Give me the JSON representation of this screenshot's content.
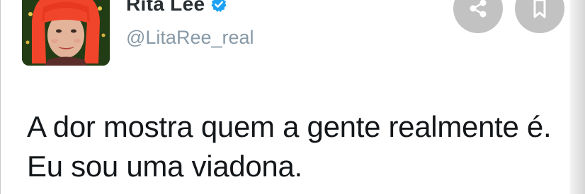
{
  "tweet": {
    "author": {
      "name": "Rita Lee",
      "handle": "@LitaRee_real",
      "verified": true
    },
    "text": "A dor mostra quem a gente realmente é. Eu sou uma viadona.",
    "actions": {
      "share_icon": "share-icon",
      "bookmark_icon": "bookmark-icon"
    }
  },
  "colors": {
    "verified_badge": "#1da1f2",
    "action_button_bg": "#c2c2c2",
    "handle_text": "#8899a6",
    "name_text": "#292f33"
  }
}
